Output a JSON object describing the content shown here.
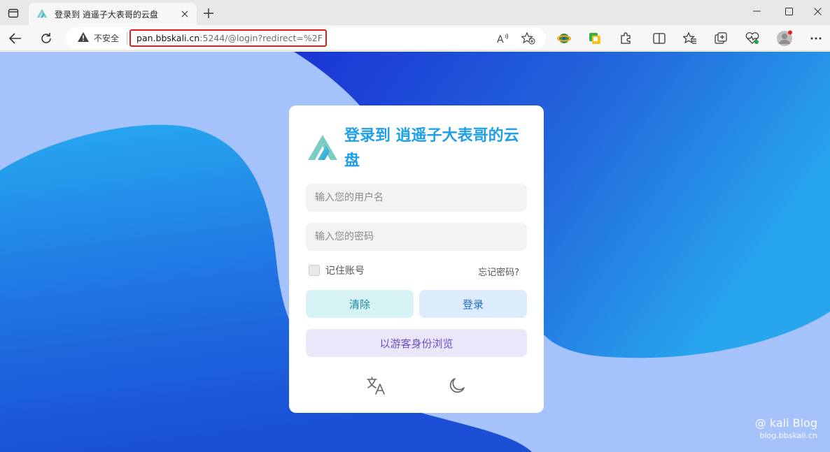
{
  "browser": {
    "tab": {
      "title": "登录到 逍遥子大表哥的云盘"
    },
    "address": {
      "security_label": "不安全",
      "url_host": "pan.bbskali.cn",
      "url_rest": ":5244/@login?redirect=%2F"
    },
    "icons": [
      "tab-actions-icon",
      "app-logo-icon",
      "close-icon",
      "plus-icon",
      "minimize-icon",
      "maximize-icon",
      "back-icon",
      "refresh-icon",
      "warning-icon",
      "read-aloud-icon",
      "add-favorite-icon",
      "extension-globe-icon",
      "extension-green-icon",
      "puzzle-icon",
      "split-screen-icon",
      "favorites-icon",
      "collections-icon",
      "heartbeat-icon",
      "avatar",
      "more-icon"
    ]
  },
  "login": {
    "title": "登录到 逍遥子大表哥的云盘",
    "username_placeholder": "输入您的用户名",
    "password_placeholder": "输入您的密码",
    "remember_label": "记住账号",
    "forgot_label": "忘记密码?",
    "clear_label": "清除",
    "login_label": "登录",
    "guest_label": "以游客身份浏览",
    "icons": [
      "translate-icon",
      "moon-icon"
    ]
  },
  "watermark": {
    "line1": "@ kali Blog",
    "line2": "blog.bbskali.cn"
  },
  "colors": {
    "accent": "#1e9fe8",
    "page_bg": "#a6c2fb",
    "deep_blue": "#1a4fd6",
    "url_outline": "#e02020"
  }
}
